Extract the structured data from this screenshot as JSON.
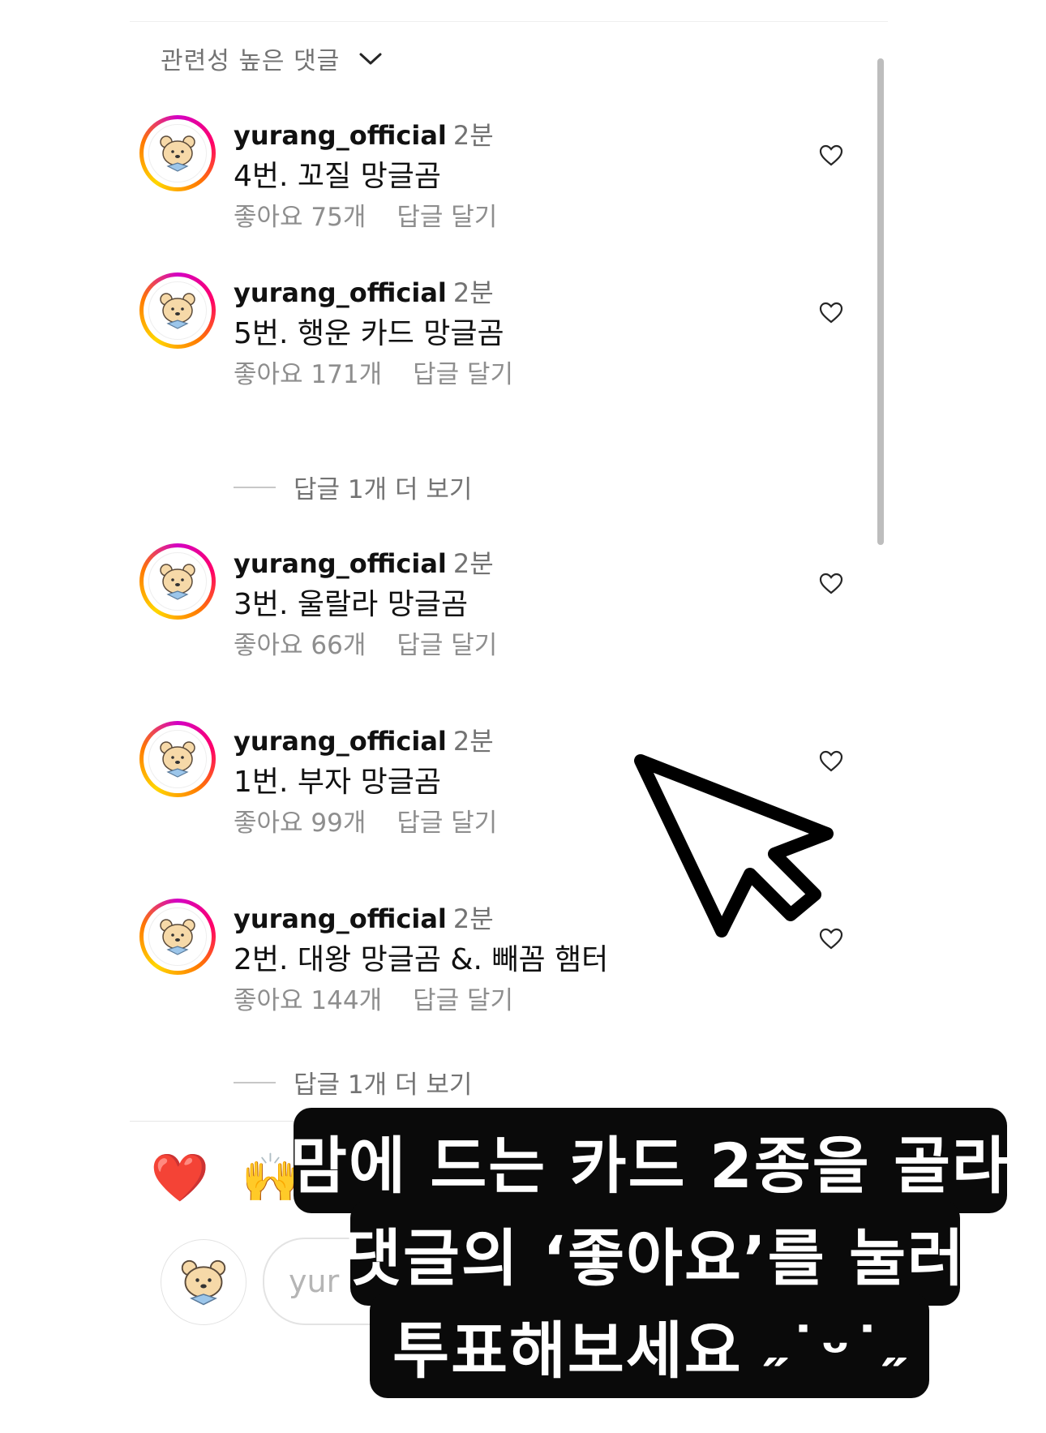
{
  "sort": {
    "label": "관련성 높은 댓글"
  },
  "comments": [
    {
      "author": "yurang_official",
      "time": "2분",
      "text": "4번. 꼬질 망글곰",
      "likes": "좋아요 75개",
      "reply": "답글 달기"
    },
    {
      "author": "yurang_official",
      "time": "2분",
      "text": "5번. 행운 카드 망글곰",
      "likes": "좋아요 171개",
      "reply": "답글 달기",
      "more_replies": "답글 1개 더 보기"
    },
    {
      "author": "yurang_official",
      "time": "2분",
      "text": "3번. 울랄라 망글곰",
      "likes": "좋아요 66개",
      "reply": "답글 달기"
    },
    {
      "author": "yurang_official",
      "time": "2분",
      "text": "1번. 부자 망글곰",
      "likes": "좋아요 99개",
      "reply": "답글 달기"
    },
    {
      "author": "yurang_official",
      "time": "2분",
      "text": "2번. 대왕 망글곰 &. 빼꼼 햄터",
      "likes": "좋아요 144개",
      "reply": "답글 달기",
      "more_replies": "답글 1개 더 보기"
    }
  ],
  "reactions": [
    "❤️",
    "🙌"
  ],
  "input": {
    "placeholder": "yur"
  },
  "overlay": {
    "line1": "맘에 드는 카드 2종을 골라",
    "line2": "댓글의 ‘좋아요’를 눌러",
    "line3": "투표해보세요 ˶˙ᵕ˙˶"
  },
  "colors": {
    "accent_ring": "#d300c5",
    "overlay_bg": "#0a0a0a",
    "muted_text": "#8e8e8e"
  }
}
